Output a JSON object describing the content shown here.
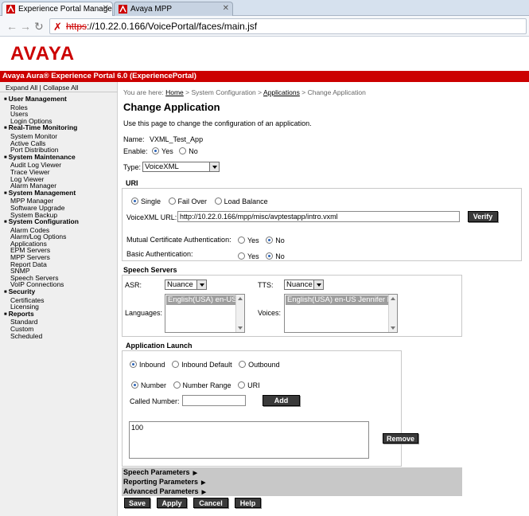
{
  "browser": {
    "tabs": [
      {
        "title": "Experience Portal Manager"
      },
      {
        "title": "Avaya MPP"
      }
    ],
    "url_scheme": "https",
    "url_rest": "://10.22.0.166/VoicePortal/faces/main.jsf"
  },
  "header": {
    "logo": "AVAYA",
    "title": "Avaya Aura® Experience Portal 6.0 (ExperiencePortal)"
  },
  "sidebar": {
    "expand_all": "Expand All",
    "separator": "|",
    "collapse_all": "Collapse All",
    "sections": [
      {
        "title": "User Management",
        "items": [
          "Roles",
          "Users",
          "Login Options"
        ]
      },
      {
        "title": "Real-Time Monitoring",
        "items": [
          "System Monitor",
          "Active Calls",
          "Port Distribution"
        ]
      },
      {
        "title": "System Maintenance",
        "items": [
          "Audit Log Viewer",
          "Trace Viewer",
          "Log Viewer",
          "Alarm Manager"
        ]
      },
      {
        "title": "System Management",
        "items": [
          "MPP Manager",
          "Software Upgrade",
          "System Backup"
        ]
      },
      {
        "title": "System Configuration",
        "items": [
          "Alarm Codes",
          "Alarm/Log Options",
          "Applications",
          "EPM Servers",
          "MPP Servers",
          "Report Data",
          "SNMP",
          "Speech Servers",
          "VoIP Connections"
        ]
      },
      {
        "title": "Security",
        "items": [
          "Certificates",
          "Licensing"
        ]
      },
      {
        "title": "Reports",
        "items": [
          "Standard",
          "Custom",
          "Scheduled"
        ]
      }
    ]
  },
  "breadcrumb": {
    "prefix": "You are here:",
    "home": "Home",
    "sep1": ">",
    "sysconfig": "System Configuration",
    "sep2": ">",
    "applications": "Applications",
    "sep3": ">",
    "current": "Change Application"
  },
  "page": {
    "title": "Change Application",
    "description": "Use this page to change the configuration of an application."
  },
  "form": {
    "name_label": "Name:",
    "name_value": "VXML_Test_App",
    "enable_label": "Enable:",
    "enable_yes": "Yes",
    "enable_no": "No",
    "type_label": "Type:",
    "type_value": "VoiceXML",
    "uri": {
      "title": "URI",
      "single": "Single",
      "failover": "Fail Over",
      "load_balance": "Load Balance",
      "vxml_url_label": "VoiceXML URL:",
      "vxml_url_value": "http://10.22.0.166/mpp/misc/avptestapp/intro.vxml",
      "verify": "Verify",
      "mutual_auth_label": "Mutual Certificate Authentication:",
      "basic_auth_label": "Basic Authentication:",
      "yes": "Yes",
      "no": "No"
    },
    "speech": {
      "title": "Speech Servers",
      "asr_label": "ASR:",
      "asr_value": "Nuance",
      "tts_label": "TTS:",
      "tts_value": "Nuance",
      "languages_label": "Languages:",
      "languages_selected": "English(USA) en-US",
      "voices_label": "Voices:",
      "voices_selected": "English(USA) en-US Jennifer F"
    },
    "launch": {
      "title": "Application Launch",
      "inbound": "Inbound",
      "inbound_default": "Inbound Default",
      "outbound": "Outbound",
      "number": "Number",
      "number_range": "Number Range",
      "uri": "URI",
      "called_number_label": "Called Number:",
      "called_number_value": "",
      "add": "Add",
      "list_value": "100",
      "remove": "Remove"
    },
    "collapsed": {
      "speech_params": "Speech Parameters",
      "reporting_params": "Reporting Parameters",
      "advanced_params": "Advanced Parameters",
      "arrow": "▶"
    },
    "buttons": {
      "save": "Save",
      "apply": "Apply",
      "cancel": "Cancel",
      "help": "Help"
    }
  },
  "colors": {
    "brand_red": "#cc0000",
    "button_dark": "#3a3a3a",
    "sidebar_bg": "#efefef"
  }
}
